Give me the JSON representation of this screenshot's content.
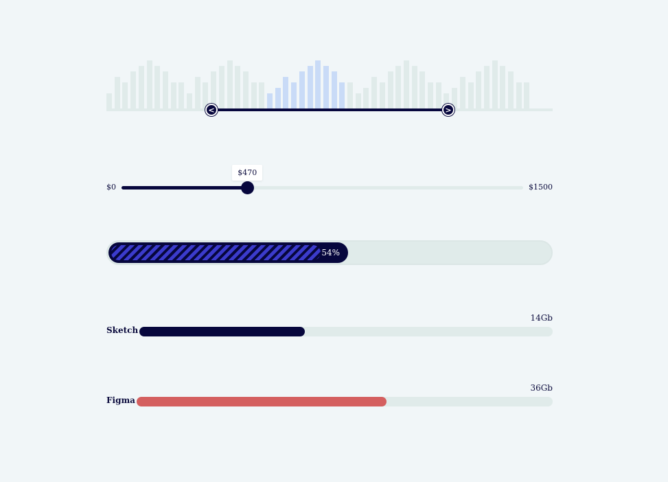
{
  "colors": {
    "background": "#f1f6f8",
    "track": "#e0ebea",
    "primary": "#07073d",
    "histogram_inactive": "#e0ebea",
    "histogram_active": "#c9dbf7",
    "stripe": "#3b3bcc",
    "figma": "#d45f5f"
  },
  "histogram": {
    "bars": [
      3,
      6,
      5,
      7,
      8,
      9,
      8,
      7,
      5,
      5,
      3,
      6,
      5,
      7,
      8,
      9,
      8,
      7,
      5,
      5,
      3,
      4,
      6,
      5,
      7,
      8,
      9,
      8,
      7,
      5,
      5,
      3,
      4,
      6,
      5,
      7,
      8,
      9,
      8,
      7,
      5,
      5,
      3,
      4,
      6,
      5,
      7,
      8,
      9,
      8,
      7,
      5,
      5
    ],
    "selected_from_index": 20,
    "selected_to_index": 29,
    "left_handle_glyph": "<",
    "right_handle_glyph": ">"
  },
  "price_slider": {
    "min_label": "$0",
    "max_label": "$1500",
    "min": 0,
    "max": 1500,
    "value": 470,
    "tooltip": "$470"
  },
  "striped_progress": {
    "percent": 54,
    "label": "54%"
  },
  "storage": [
    {
      "name": "Sketch",
      "size": "14Gb",
      "fraction": 0.4,
      "color": "#07073d"
    },
    {
      "name": "Figma",
      "size": "36Gb",
      "fraction": 0.6,
      "color": "#d45f5f"
    }
  ]
}
